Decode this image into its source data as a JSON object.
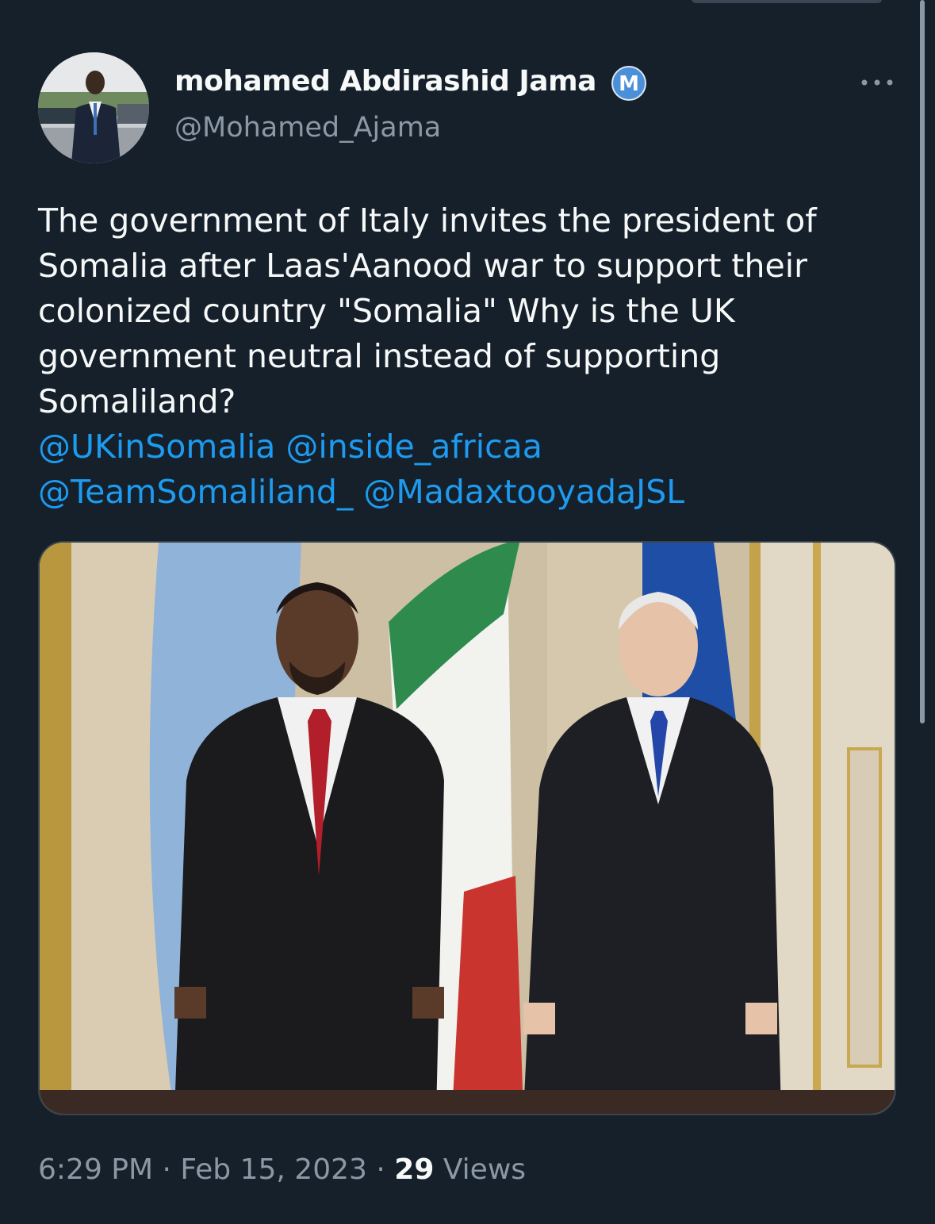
{
  "tweet": {
    "author": {
      "display_name": "mohamed Abdirashid Jama",
      "handle": "@Mohamed_Ajama",
      "badge_letter": "M",
      "badge_icon": "m-badge-icon",
      "avatar": "profile-photo"
    },
    "more_icon": "more-horizontal-icon",
    "text": "The government of Italy invites the president of Somalia after Laas'Aanood war to support their colonized country \"Somalia\" Why is the UK government neutral instead of supporting Somaliland?",
    "mentions": [
      "@UKinSomalia",
      "@inside_africaa",
      "@TeamSomaliland_",
      "@MadaxtooyadaJSL"
    ],
    "media": {
      "kind": "photo",
      "description_icon": "photo-two-men-with-flags"
    },
    "meta": {
      "time": "6:29 PM",
      "date": "Feb 15, 2023",
      "separator": "·",
      "views_count": "29",
      "views_label": "Views"
    }
  },
  "colors": {
    "background": "#15202b",
    "text": "#f7f9f9",
    "secondary_text": "#8b98a5",
    "link": "#1d9bf0",
    "badge": "#4a90d9"
  }
}
